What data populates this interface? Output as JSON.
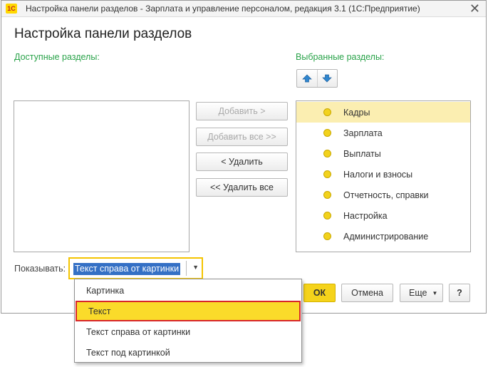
{
  "window": {
    "title": "Настройка панели разделов - Зарплата и управление персоналом, редакция 3.1  (1С:Предприятие)",
    "logo_text": "1С",
    "close_glyph": "✕"
  },
  "heading": "Настройка панели разделов",
  "available": {
    "label": "Доступные разделы:",
    "items": []
  },
  "selected": {
    "label": "Выбранные разделы:",
    "items": [
      {
        "label": "Кадры",
        "selected": true
      },
      {
        "label": "Зарплата"
      },
      {
        "label": "Выплаты"
      },
      {
        "label": "Налоги и взносы"
      },
      {
        "label": "Отчетность, справки"
      },
      {
        "label": "Настройка"
      },
      {
        "label": "Администрирование"
      }
    ]
  },
  "buttons": {
    "add": "Добавить >",
    "add_all": "Добавить все >>",
    "remove": "< Удалить",
    "remove_all": "<< Удалить все",
    "ok": "ОК",
    "cancel": "Отмена",
    "more": "Еще",
    "help": "?"
  },
  "show": {
    "label": "Показывать:",
    "value": "Текст справа от картинки",
    "options": [
      {
        "label": "Картинка"
      },
      {
        "label": "Текст",
        "highlighted": true
      },
      {
        "label": "Текст справа от картинки"
      },
      {
        "label": "Текст под картинкой"
      }
    ]
  },
  "colors": {
    "accent_green": "#2aa34a",
    "highlight_yellow": "#fadb2a",
    "highlight_border": "#d8262a",
    "selection_blue": "#3470c5",
    "bullet_yellow": "#f2d21d",
    "arrow_blue": "#2f86cf"
  },
  "icons": {
    "move_up": "arrow-up-icon",
    "move_down": "arrow-down-icon"
  }
}
